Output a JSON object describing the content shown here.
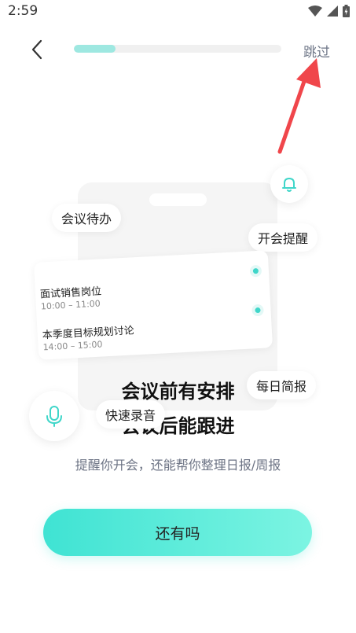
{
  "status_bar": {
    "time": "2:59"
  },
  "header": {
    "skip_label": "跳过",
    "progress": 0.2
  },
  "chips": {
    "meeting_todo": "会议待办",
    "meeting_reminder": "开会提醒",
    "daily_report": "每日简报",
    "quick_record": "快速录音"
  },
  "card": {
    "items": [
      {
        "title": "面试销售岗位",
        "time": "10:00 – 11:00"
      },
      {
        "title": "本季度目标规划讨论",
        "time": "14:00 – 15:00"
      }
    ]
  },
  "headline": {
    "line1": "会议前有安排",
    "line2": "会议后能跟进"
  },
  "subtitle": "提醒你开会，还能帮你整理日报/周报",
  "cta": {
    "label": "还有吗"
  },
  "icons": [
    "back-chevron-icon",
    "wifi-icon",
    "signal-icon",
    "battery-icon",
    "bell-icon",
    "microphone-icon"
  ],
  "colors": {
    "accent": "#3fe3d3",
    "arrow": "#f0464b"
  }
}
